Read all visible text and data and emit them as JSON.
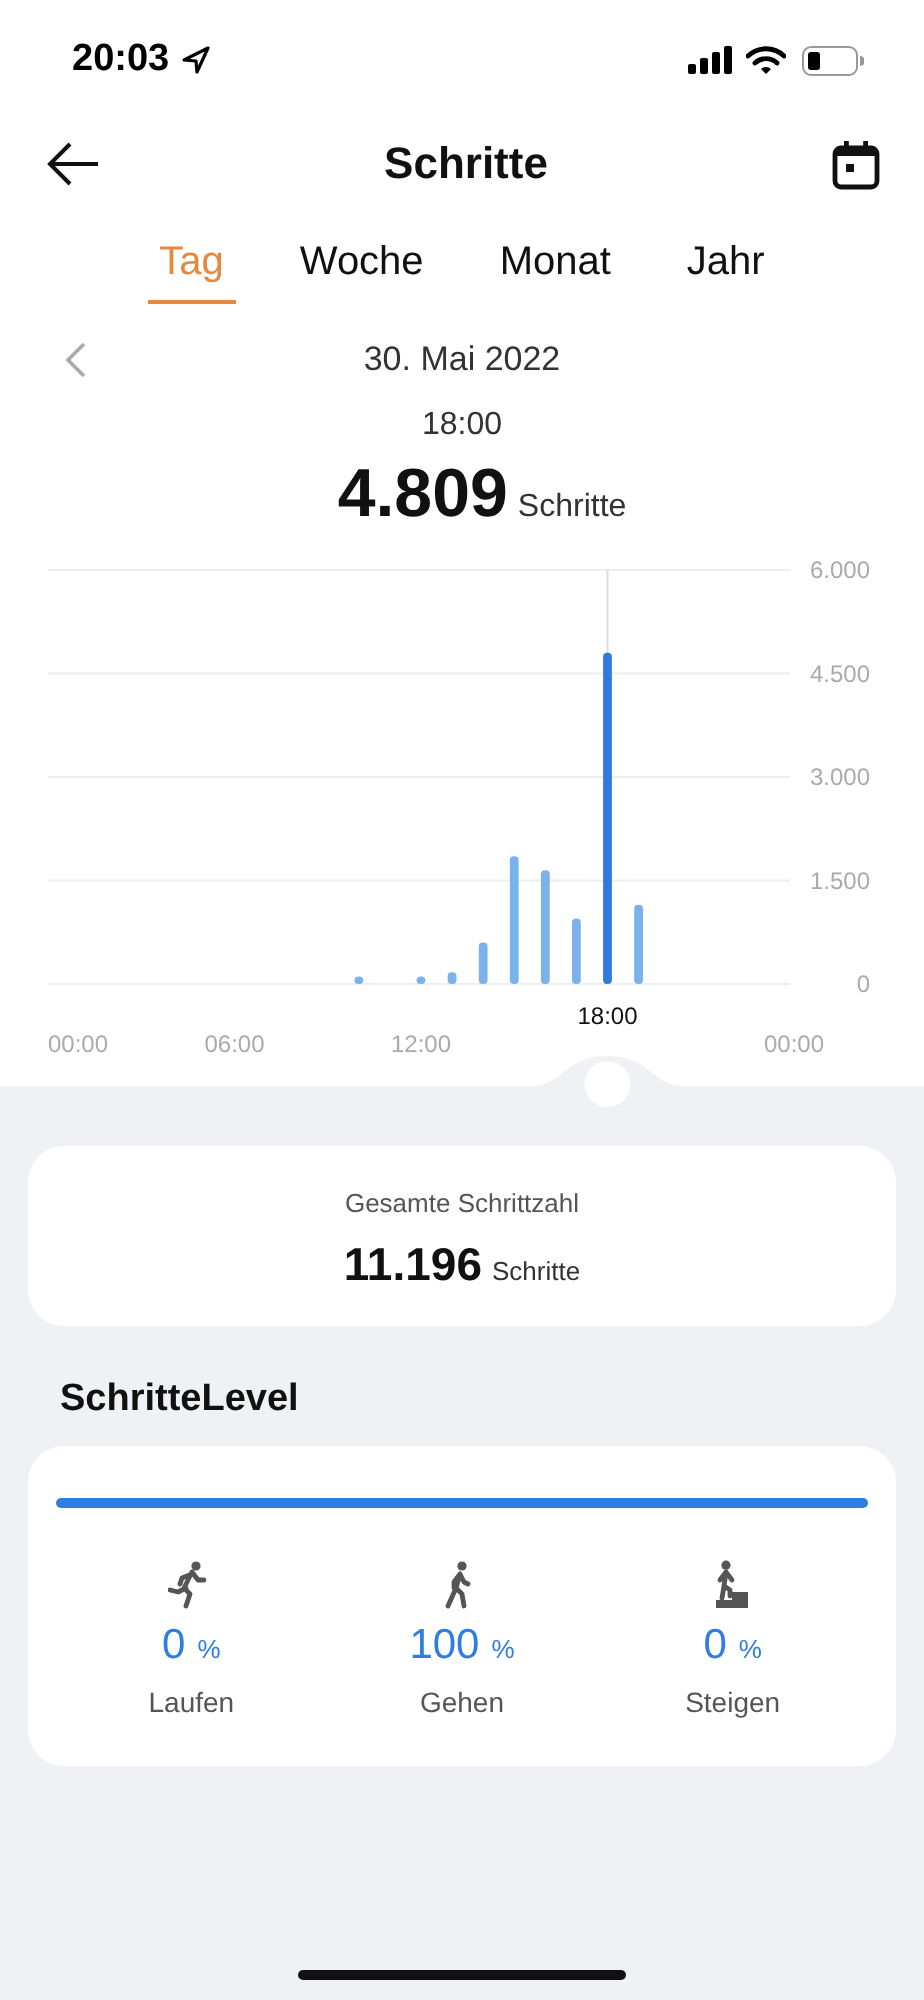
{
  "status_bar": {
    "time": "20:03"
  },
  "header": {
    "title": "Schritte"
  },
  "tabs": [
    {
      "label": "Tag",
      "selected": true
    },
    {
      "label": "Woche",
      "selected": false
    },
    {
      "label": "Monat",
      "selected": false
    },
    {
      "label": "Jahr",
      "selected": false
    }
  ],
  "date": "30. Mai 2022",
  "reading": {
    "time": "18:00",
    "value": "4.809",
    "unit": "Schritte"
  },
  "chart": {
    "chart_data": {
      "type": "bar",
      "x": [
        10,
        12,
        13,
        14,
        15,
        16,
        17,
        18,
        19
      ],
      "grid": true,
      "series": [
        {
          "color": "#7ab3ec",
          "values": [
            110,
            110,
            170,
            600,
            1850,
            1650,
            950,
            null,
            1150
          ]
        },
        {
          "color": "#2e7be0",
          "values": [
            null,
            null,
            null,
            null,
            null,
            null,
            null,
            4800,
            null
          ]
        }
      ],
      "annotations": [
        {
          "x": 18,
          "text": "18:00"
        }
      ],
      "ylim": [
        0,
        6000
      ],
      "yticks": [
        {
          "value": 0,
          "label": "0"
        },
        {
          "value": 1500,
          "label": "1.500"
        },
        {
          "value": 3000,
          "label": "3.000"
        },
        {
          "value": 4500,
          "label": "4.500"
        },
        {
          "value": 6000,
          "label": "6.000"
        }
      ],
      "xlim": [
        0,
        24
      ],
      "xticks": [
        {
          "value": 0,
          "label": "00:00"
        },
        {
          "value": 6,
          "label": "06:00"
        },
        {
          "value": 12,
          "label": "12:00"
        },
        {
          "value": 24,
          "label": "00:00"
        }
      ]
    }
  },
  "total": {
    "label": "Gesamte Schrittzahl",
    "value": "11.196",
    "unit": "Schritte"
  },
  "level_section": {
    "title": "SchritteLevel",
    "items": [
      {
        "kind": "run",
        "value": "0",
        "unit": "%",
        "label": "Laufen"
      },
      {
        "kind": "walk",
        "value": "100",
        "unit": "%",
        "label": "Gehen"
      },
      {
        "kind": "climb",
        "value": "0",
        "unit": "%",
        "label": "Steigen"
      }
    ]
  }
}
